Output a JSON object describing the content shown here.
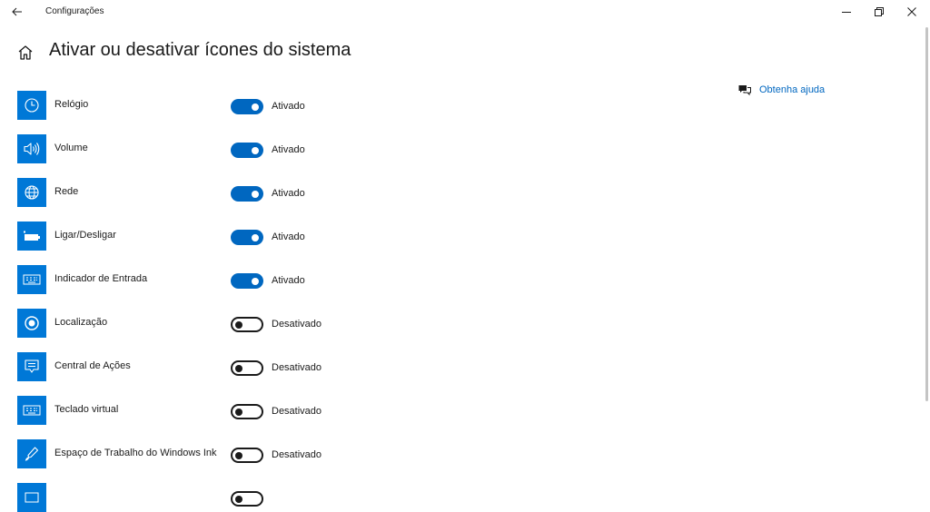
{
  "window": {
    "title": "Configurações"
  },
  "page": {
    "title": "Ativar ou desativar ícones do sistema"
  },
  "help": {
    "label": "Obtenha ajuda"
  },
  "colors": {
    "accent": "#0078d7",
    "toggle_on": "#0067c0",
    "link": "#0067c0"
  },
  "items": [
    {
      "label": "Relógio",
      "icon": "clock-icon",
      "on": true,
      "state": "Ativado"
    },
    {
      "label": "Volume",
      "icon": "volume-icon",
      "on": true,
      "state": "Ativado"
    },
    {
      "label": "Rede",
      "icon": "network-globe-icon",
      "on": true,
      "state": "Ativado"
    },
    {
      "label": "Ligar/Desligar",
      "icon": "battery-icon",
      "on": true,
      "state": "Ativado"
    },
    {
      "label": "Indicador de Entrada",
      "icon": "keyboard-icon",
      "on": true,
      "state": "Ativado"
    },
    {
      "label": "Localização",
      "icon": "location-icon",
      "on": false,
      "state": "Desativado"
    },
    {
      "label": "Central de Ações",
      "icon": "action-center-icon",
      "on": false,
      "state": "Desativado"
    },
    {
      "label": "Teclado virtual",
      "icon": "touch-keyboard-icon",
      "on": false,
      "state": "Desativado"
    },
    {
      "label": "Espaço de Trabalho do Windows Ink",
      "icon": "pen-ink-icon",
      "on": false,
      "state": "Desativado"
    },
    {
      "label": "",
      "icon": "touchpad-icon",
      "on": false,
      "state": ""
    }
  ]
}
